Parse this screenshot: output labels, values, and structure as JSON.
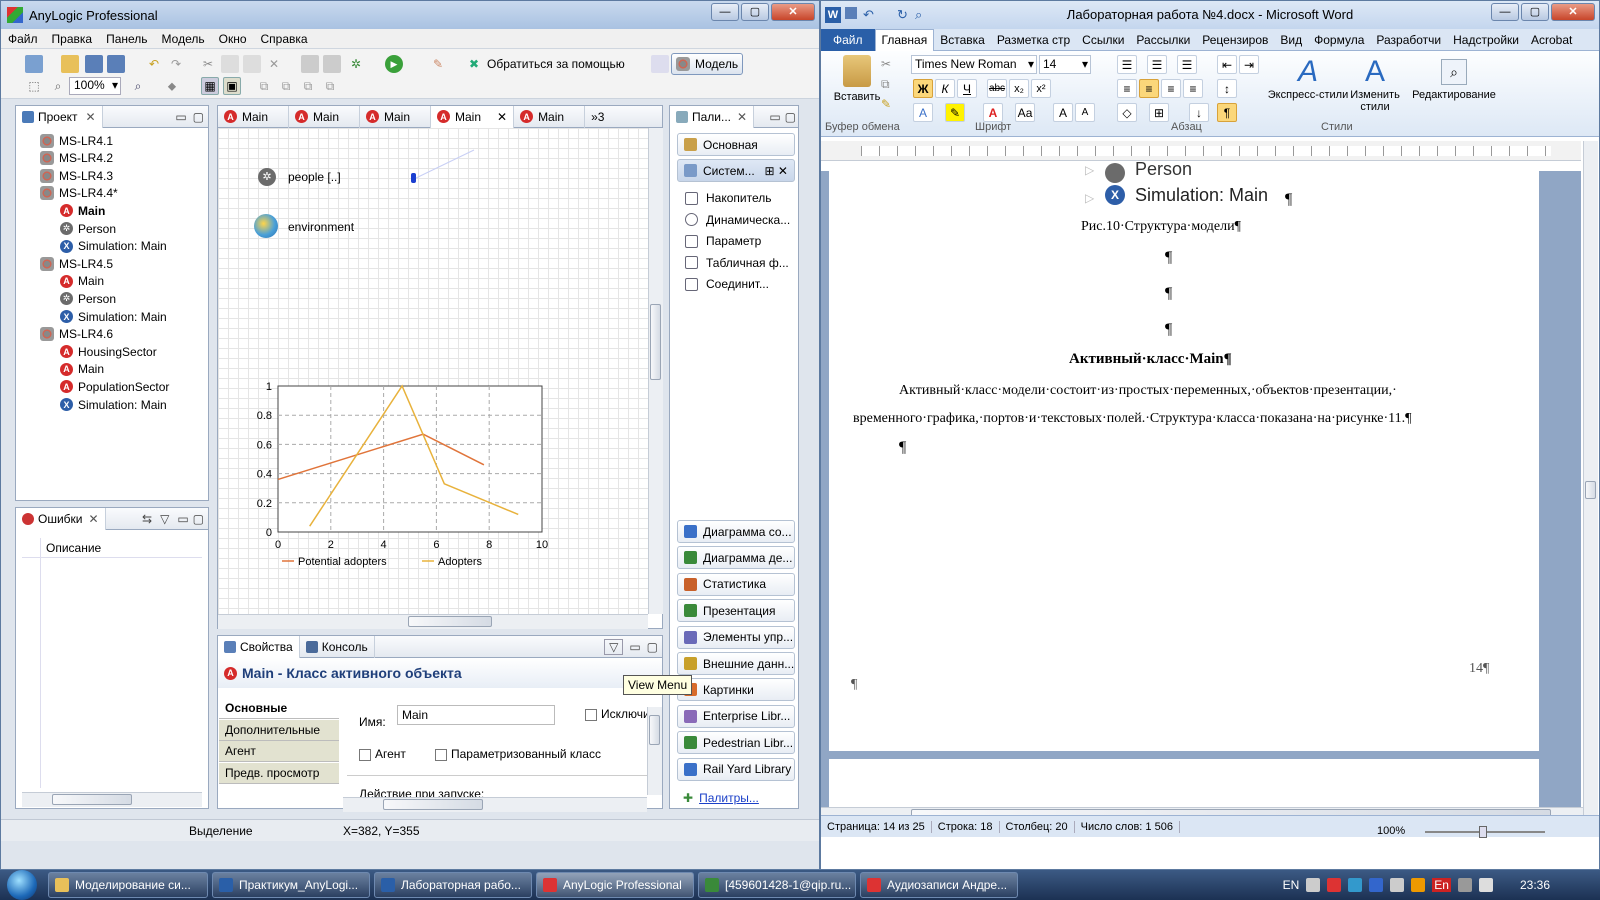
{
  "anylogic": {
    "title": "AnyLogic Professional",
    "menu": [
      "Файл",
      "Правка",
      "Панель",
      "Модель",
      "Окно",
      "Справка"
    ],
    "zoom": "100%",
    "help_label": "Обратиться за помощью",
    "perspective_label": "Модель",
    "project_tab": "Проект",
    "editor_tabs": [
      "Main",
      "Main",
      "Main",
      "Main",
      "Main"
    ],
    "overflow_count": "3",
    "tree": [
      {
        "label": "MS-LR4.1",
        "type": "model",
        "level": 0
      },
      {
        "label": "MS-LR4.2",
        "type": "model",
        "level": 0
      },
      {
        "label": "MS-LR4.3",
        "type": "model",
        "level": 0
      },
      {
        "label": "MS-LR4.4*",
        "type": "model",
        "level": 0
      },
      {
        "label": "Main",
        "type": "active",
        "level": 1,
        "bold": true
      },
      {
        "label": "Person",
        "type": "person",
        "level": 1
      },
      {
        "label": "Simulation: Main",
        "type": "sim",
        "level": 1
      },
      {
        "label": "MS-LR4.5",
        "type": "model",
        "level": 0
      },
      {
        "label": "Main",
        "type": "active",
        "level": 1
      },
      {
        "label": "Person",
        "type": "person",
        "level": 1
      },
      {
        "label": "Simulation: Main",
        "type": "sim",
        "level": 1
      },
      {
        "label": "MS-LR4.6",
        "type": "model",
        "level": 0
      },
      {
        "label": "HousingSector",
        "type": "active",
        "level": 1
      },
      {
        "label": "Main",
        "type": "active",
        "level": 1
      },
      {
        "label": "PopulationSector",
        "type": "active",
        "level": 1
      },
      {
        "label": "Simulation: Main",
        "type": "sim",
        "level": 1
      }
    ],
    "errors_tab": "Ошибки",
    "errors_col": "Описание",
    "canvas": {
      "people_label": "people [..]",
      "environment_label": "environment"
    },
    "palette_tab": "Пали...",
    "palette_basic": "Основная",
    "palette_system": "Систем...",
    "palette_items": [
      "Накопитель",
      "Динамическа...",
      "Параметр",
      "Табличная ф...",
      "Соединит..."
    ],
    "palette_sections": [
      "Диаграмма со...",
      "Диаграмма де...",
      "Статистика",
      "Презентация",
      "Элементы упр...",
      "Внешние данн...",
      "Картинки",
      "Enterprise Libr...",
      "Pedestrian Libr...",
      "Rail Yard Library"
    ],
    "palette_link": "Палитры...",
    "props_tab": "Свойства",
    "console_tab": "Консоль",
    "props_header": "Main - Класс активного объекта",
    "props_sidetabs": [
      "Основные",
      "Дополнительные",
      "Агент",
      "Предв. просмотр"
    ],
    "name_label": "Имя:",
    "name_value": "Main",
    "exclude_label": "Исключи",
    "agent_label": "Агент",
    "param_class_label": "Параметризованный класс",
    "startup_label": "Действие при запуске:",
    "tooltip": "View Menu",
    "status_mode": "Выделение",
    "status_coords": "X=382, Y=355"
  },
  "chart_data": {
    "type": "line",
    "xlim": [
      0,
      10
    ],
    "ylim": [
      0,
      1
    ],
    "xticks": [
      "0",
      "2",
      "4",
      "6",
      "8",
      "10"
    ],
    "yticks": [
      "0",
      "0.2",
      "0.4",
      "0.6",
      "0.8",
      "1"
    ],
    "grid": true,
    "legend": "bottom",
    "series": [
      {
        "name": "Potential adopters",
        "color": "#e0743a",
        "x": [
          0,
          5.5,
          7.8
        ],
        "y": [
          0.36,
          0.67,
          0.46
        ]
      },
      {
        "name": "Adopters",
        "color": "#e8b23c",
        "x": [
          1.2,
          4.7,
          6.3,
          9.1
        ],
        "y": [
          0.04,
          1.0,
          0.33,
          0.12
        ]
      }
    ]
  },
  "word": {
    "title": "Лабораторная работа №4.docx - Microsoft Word",
    "tabs": [
      "Файл",
      "Главная",
      "Вставка",
      "Разметка стр",
      "Ссылки",
      "Рассылки",
      "Рецензиров",
      "Вид",
      "Формула",
      "Разработчи",
      "Надстройки",
      "Acrobat"
    ],
    "paste_label": "Вставить",
    "clipboard_label": "Буфер обмена",
    "font_name": "Times New Roman",
    "font_size": "14",
    "font_group": "Шрифт",
    "para_group": "Абзац",
    "styles_group": "Стили",
    "express_styles": "Экспресс-стили",
    "change_styles": "Изменить стили",
    "editing": "Редактирование",
    "doc": {
      "tree_person": "Person",
      "tree_sim": "Simulation: Main",
      "caption": "Рис.10·Структура·модели¶",
      "pilcrow": "¶",
      "heading": "Активный·класс·Main¶",
      "para1": "Активный·класс·модели·состоит·из·простых·переменных,·объектов·презентации,·",
      "para2": "временного·графика,·портов·и·текстовых·полей.·Структура·класса·показана·на·рисунке·11.¶",
      "page_num": "14¶"
    },
    "status": [
      "Страница: 14 из 25",
      "Строка: 18",
      "Столбец: 20",
      "Число слов: 1 506"
    ],
    "zoom": "100%"
  },
  "taskbar": {
    "items": [
      "Моделирование си...",
      "Практикум_AnyLogi...",
      "Лабораторная рабо...",
      "AnyLogic Professional",
      "[459601428-1@qip.ru...",
      "Аудиозаписи Андре..."
    ],
    "lang": "EN",
    "lang2": "En",
    "time": "23:36"
  }
}
